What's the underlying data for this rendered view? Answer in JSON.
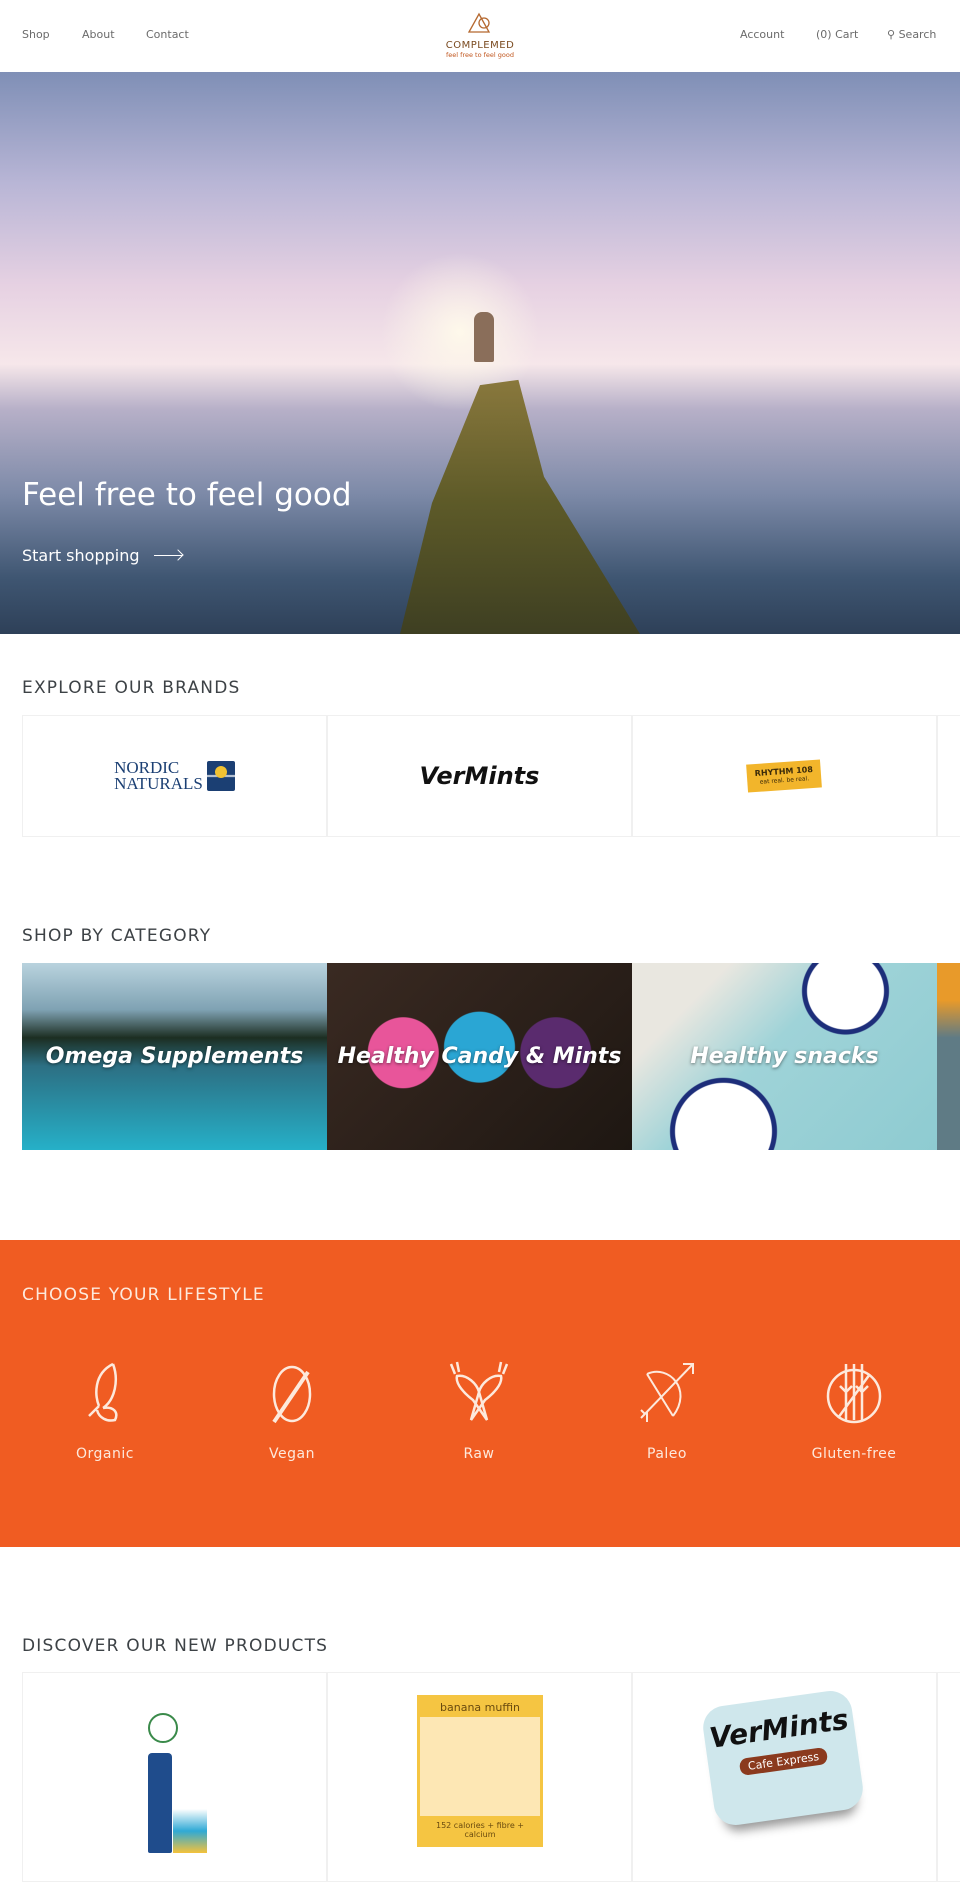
{
  "header": {
    "nav_left": [
      "Shop",
      "About",
      "Contact"
    ],
    "logo": {
      "name": "COMPLEMED",
      "tagline": "feel free to feel good"
    },
    "account": "Account",
    "cart": "(0) Cart",
    "search": "Search"
  },
  "hero": {
    "title": "Feel free to feel good",
    "cta": "Start shopping"
  },
  "brands": {
    "title": "EXPLORE OUR BRANDS",
    "items": [
      {
        "name": "NORDIC NATURALS",
        "line1": "NORDIC",
        "line2": "NATURALS"
      },
      {
        "name": "VerMints"
      },
      {
        "name": "RHYTHM 108",
        "tagline": "eat real. be real."
      }
    ]
  },
  "categories": {
    "title": "SHOP BY CATEGORY",
    "items": [
      "Omega Supplements",
      "Healthy Candy & Mints",
      "Healthy snacks"
    ]
  },
  "lifestyle": {
    "title": "CHOOSE YOUR LIFESTYLE",
    "background": "#f05c22",
    "items": [
      {
        "label": "Organic",
        "icon": "leaf-icon"
      },
      {
        "label": "Vegan",
        "icon": "no-egg-icon"
      },
      {
        "label": "Raw",
        "icon": "carrots-icon"
      },
      {
        "label": "Paleo",
        "icon": "bow-arrow-icon"
      },
      {
        "label": "Gluten-free",
        "icon": "no-wheat-icon"
      }
    ]
  },
  "products": {
    "title": "DISCOVER OUR NEW PRODUCTS",
    "items": [
      {
        "image": "vitamin-d3-vegan"
      },
      {
        "image": "banana-muffin-bar",
        "label": "banana muffin",
        "caption": "152 calories + fibre + calcium"
      },
      {
        "image": "vermints-cafe-express",
        "label": "VerMints",
        "caption": "Cafe Express"
      }
    ]
  }
}
